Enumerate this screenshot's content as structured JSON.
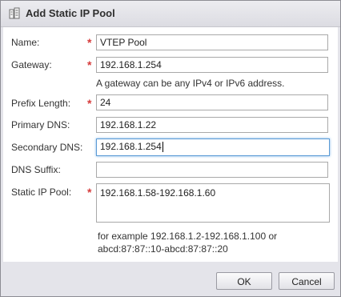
{
  "dialog": {
    "title": "Add Static IP Pool",
    "title_icon": "ip-pool-icon"
  },
  "form": {
    "name": {
      "label": "Name:",
      "required": "*",
      "value": "VTEP Pool"
    },
    "gateway": {
      "label": "Gateway:",
      "required": "*",
      "value": "192.168.1.254",
      "hint": "A gateway can be any IPv4 or IPv6 address."
    },
    "prefix_length": {
      "label": "Prefix Length:",
      "required": "*",
      "value": "24"
    },
    "primary_dns": {
      "label": "Primary DNS:",
      "value": "192.168.1.22"
    },
    "secondary_dns": {
      "label": "Secondary DNS:",
      "value": "192.168.1.254"
    },
    "dns_suffix": {
      "label": "DNS Suffix:",
      "value": ""
    },
    "static_ip_pool": {
      "label": "Static IP Pool:",
      "required": "*",
      "value": "192.168.1.58-192.168.1.60",
      "hint_line1": "for example 192.168.1.2-192.168.1.100 or",
      "hint_line2": "abcd:87:87::10-abcd:87:87::20"
    }
  },
  "buttons": {
    "ok": "OK",
    "cancel": "Cancel"
  },
  "colors": {
    "required_marker": "#d63c3c",
    "focus_border": "#5b9bd5"
  }
}
